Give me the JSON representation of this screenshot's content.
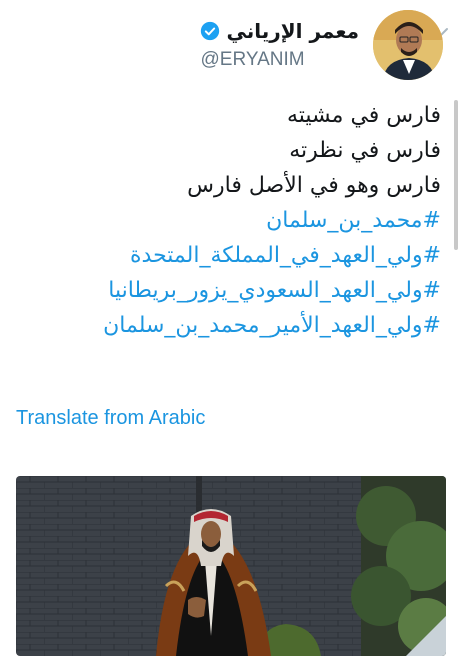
{
  "user": {
    "display_name": "معمر الإرياني",
    "handle": "@ERYANIM"
  },
  "tweet": {
    "lines": [
      "فارس في مشيته",
      "فارس في نظرته",
      "فارس وهو في الأصل فارس"
    ],
    "hashtags": [
      "#محمد_بن_سلمان",
      "#ولي_العهد_في_المملكة_المتحدة",
      "#ولي_العهد_السعودي_يزور_بريطانيا",
      "#ولي_العهد_الأمير_محمد_بن_سلمان"
    ]
  },
  "translate_label": "Translate from Arabic",
  "colors": {
    "link": "#1b95e0",
    "text": "#14171a",
    "handle": "#657786"
  },
  "icons": {
    "menu": "chevron-down-icon",
    "verified": "verified-badge-icon"
  }
}
